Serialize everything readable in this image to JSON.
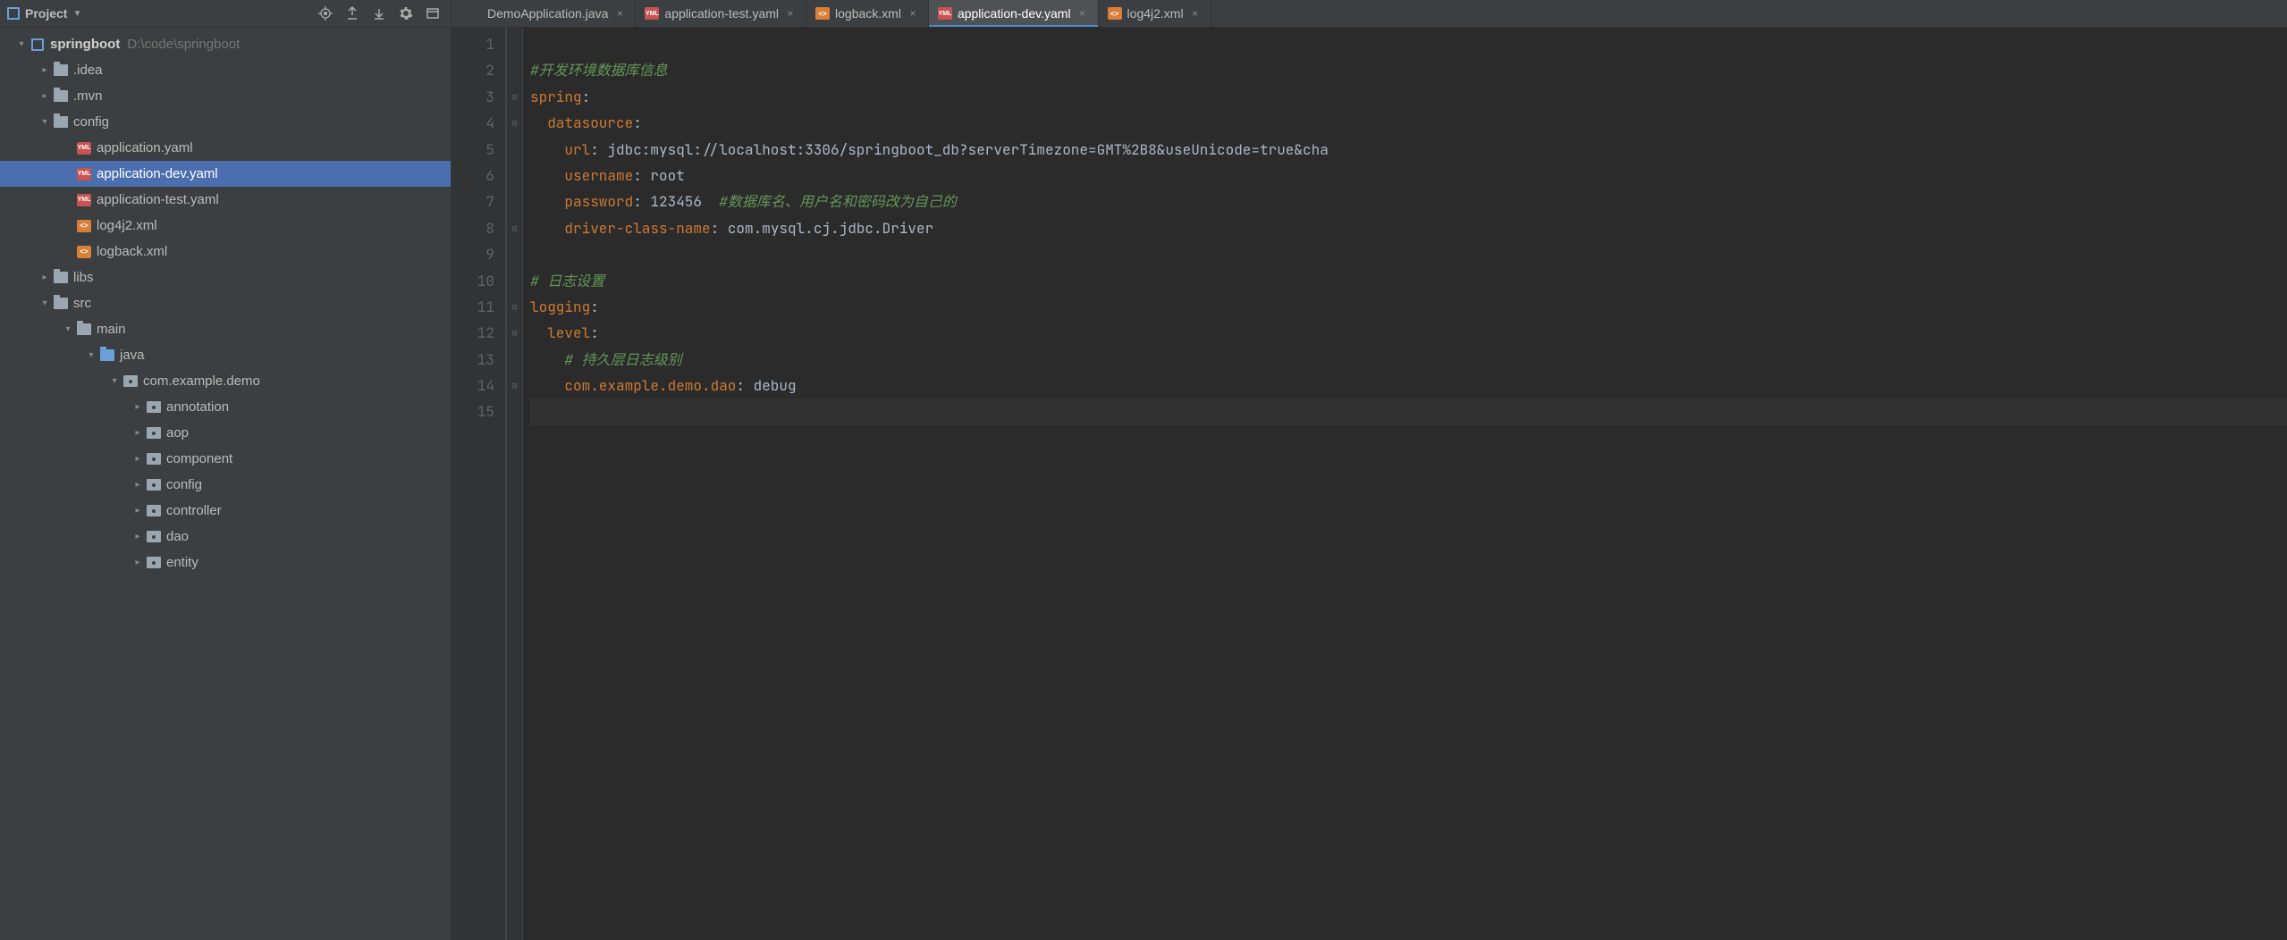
{
  "panel": {
    "title": "Project"
  },
  "project": {
    "name": "springboot",
    "path": "D:\\code\\springboot"
  },
  "tree": [
    {
      "depth": 0,
      "toggle": "down",
      "icon": "module",
      "label": "springboot",
      "bold": true,
      "path": "D:\\code\\springboot"
    },
    {
      "depth": 1,
      "toggle": "right",
      "icon": "folder",
      "label": ".idea"
    },
    {
      "depth": 1,
      "toggle": "right",
      "icon": "folder",
      "label": ".mvn"
    },
    {
      "depth": 1,
      "toggle": "down",
      "icon": "folder",
      "label": "config"
    },
    {
      "depth": 2,
      "toggle": "",
      "icon": "yaml",
      "label": "application.yaml"
    },
    {
      "depth": 2,
      "toggle": "",
      "icon": "yaml",
      "label": "application-dev.yaml",
      "selected": true
    },
    {
      "depth": 2,
      "toggle": "",
      "icon": "yaml",
      "label": "application-test.yaml"
    },
    {
      "depth": 2,
      "toggle": "",
      "icon": "xml",
      "label": "log4j2.xml"
    },
    {
      "depth": 2,
      "toggle": "",
      "icon": "xml",
      "label": "logback.xml"
    },
    {
      "depth": 1,
      "toggle": "right",
      "icon": "folder",
      "label": "libs"
    },
    {
      "depth": 1,
      "toggle": "down",
      "icon": "folder",
      "label": "src"
    },
    {
      "depth": 2,
      "toggle": "down",
      "icon": "folder",
      "label": "main"
    },
    {
      "depth": 3,
      "toggle": "down",
      "icon": "folder-blue",
      "label": "java"
    },
    {
      "depth": 4,
      "toggle": "down",
      "icon": "pkg",
      "label": "com.example.demo"
    },
    {
      "depth": 5,
      "toggle": "right",
      "icon": "pkg",
      "label": "annotation"
    },
    {
      "depth": 5,
      "toggle": "right",
      "icon": "pkg",
      "label": "aop"
    },
    {
      "depth": 5,
      "toggle": "right",
      "icon": "pkg",
      "label": "component"
    },
    {
      "depth": 5,
      "toggle": "right",
      "icon": "pkg",
      "label": "config"
    },
    {
      "depth": 5,
      "toggle": "right",
      "icon": "pkg",
      "label": "controller"
    },
    {
      "depth": 5,
      "toggle": "right",
      "icon": "pkg",
      "label": "dao"
    },
    {
      "depth": 5,
      "toggle": "right",
      "icon": "pkg",
      "label": "entity"
    }
  ],
  "tabs": [
    {
      "icon": "springboot",
      "label": "DemoApplication.java",
      "active": false
    },
    {
      "icon": "yaml",
      "label": "application-test.yaml",
      "active": false
    },
    {
      "icon": "xml",
      "label": "logback.xml",
      "active": false
    },
    {
      "icon": "yaml",
      "label": "application-dev.yaml",
      "active": true
    },
    {
      "icon": "xml",
      "label": "log4j2.xml",
      "active": false
    }
  ],
  "editor": {
    "lines": [
      {
        "n": 1,
        "parts": []
      },
      {
        "n": 2,
        "parts": [
          {
            "t": "#开发环境数据库信息",
            "c": "c-comment-it"
          }
        ]
      },
      {
        "n": 3,
        "fold": "−",
        "parts": [
          {
            "t": "spring",
            "c": "c-key"
          },
          {
            "t": ":",
            "c": "c-val"
          }
        ]
      },
      {
        "n": 4,
        "fold": "−",
        "parts": [
          {
            "t": "  datasource",
            "c": "c-key"
          },
          {
            "t": ":",
            "c": "c-val"
          }
        ]
      },
      {
        "n": 5,
        "parts": [
          {
            "t": "    url",
            "c": "c-key"
          },
          {
            "t": ": ",
            "c": "c-val"
          },
          {
            "t": "jdbc:mysql://localhost:3306/springboot_db?serverTimezone=GMT%2B8&useUnicode=true&cha",
            "c": "c-val"
          }
        ]
      },
      {
        "n": 6,
        "parts": [
          {
            "t": "    username",
            "c": "c-key"
          },
          {
            "t": ": ",
            "c": "c-val"
          },
          {
            "t": "root",
            "c": "c-val"
          }
        ]
      },
      {
        "n": 7,
        "parts": [
          {
            "t": "    password",
            "c": "c-key"
          },
          {
            "t": ": ",
            "c": "c-val"
          },
          {
            "t": "123456",
            "c": "c-val"
          },
          {
            "t": "  #数据库名、用户名和密码改为自己的",
            "c": "c-comment-it"
          }
        ]
      },
      {
        "n": 8,
        "fold": "−",
        "parts": [
          {
            "t": "    driver-class-name",
            "c": "c-key"
          },
          {
            "t": ": ",
            "c": "c-val"
          },
          {
            "t": "com.mysql.cj.jdbc.Driver",
            "c": "c-val"
          }
        ]
      },
      {
        "n": 9,
        "parts": []
      },
      {
        "n": 10,
        "parts": [
          {
            "t": "# 日志设置",
            "c": "c-comment-it"
          }
        ]
      },
      {
        "n": 11,
        "fold": "−",
        "parts": [
          {
            "t": "logging",
            "c": "c-key"
          },
          {
            "t": ":",
            "c": "c-val"
          }
        ]
      },
      {
        "n": 12,
        "fold": "−",
        "parts": [
          {
            "t": "  level",
            "c": "c-key"
          },
          {
            "t": ":",
            "c": "c-val"
          }
        ]
      },
      {
        "n": 13,
        "parts": [
          {
            "t": "    # 持久层日志级别",
            "c": "c-comment-it"
          }
        ]
      },
      {
        "n": 14,
        "fold": "−",
        "parts": [
          {
            "t": "    com.example.demo.dao",
            "c": "c-key"
          },
          {
            "t": ": ",
            "c": "c-val"
          },
          {
            "t": "debug",
            "c": "c-val"
          }
        ]
      },
      {
        "n": 15,
        "current": true,
        "parts": []
      }
    ]
  }
}
